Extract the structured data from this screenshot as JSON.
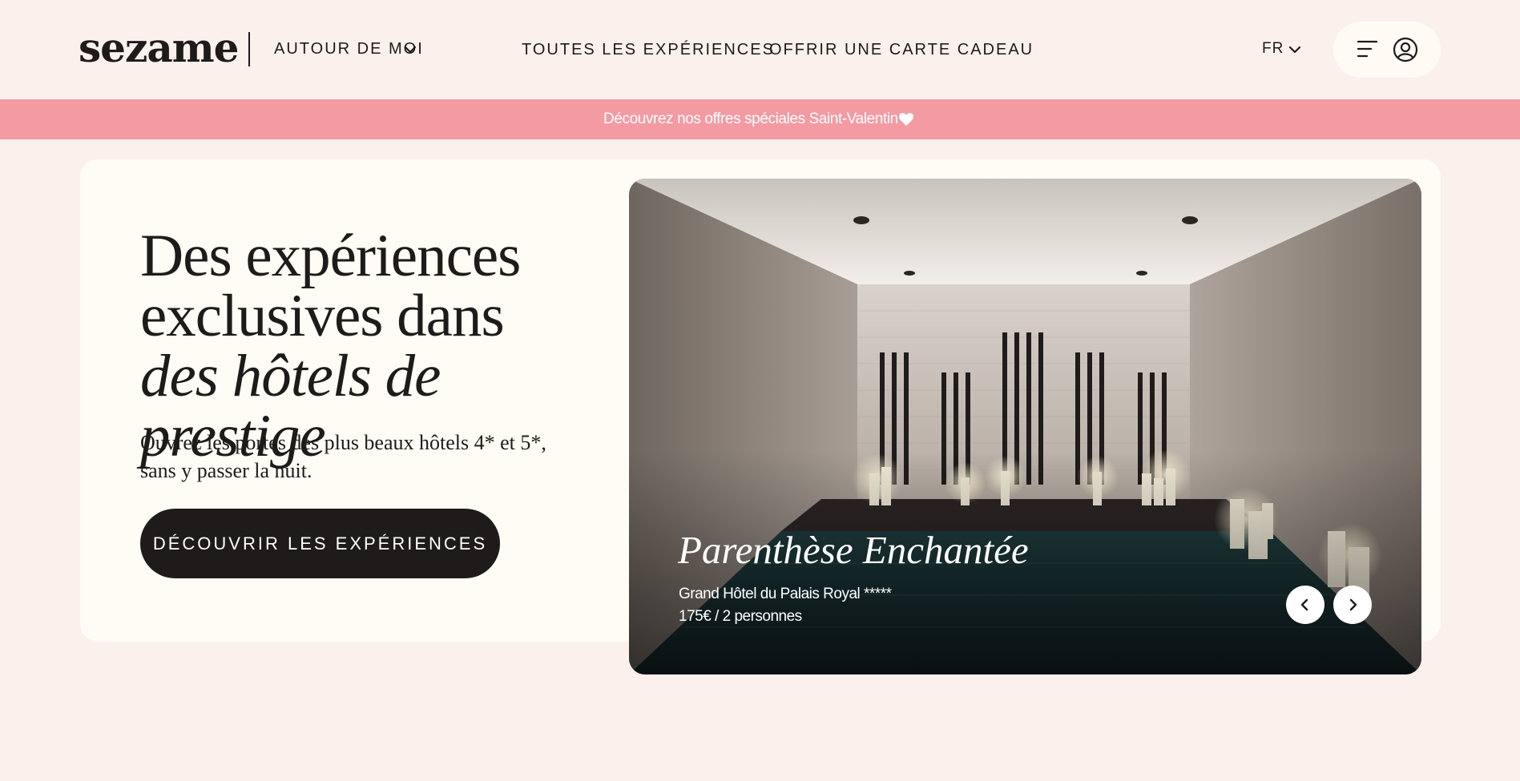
{
  "header": {
    "logo": "sezame",
    "about_label": "AUTOUR DE MOI",
    "nav": {
      "experiences": "TOUTES LES EXPÉRIENCES",
      "gift_card": "OFFRIR UNE CARTE CADEAU"
    },
    "language": "FR",
    "icons": [
      "chevron-down-icon",
      "menu-icon",
      "user-icon"
    ]
  },
  "promo": {
    "text": "Découvrez nos offres spéciales Saint-Valentin",
    "icon": "heart-icon",
    "background": "#f49aa3"
  },
  "hero": {
    "title_line1": "Des expériences",
    "title_line2": "exclusives dans",
    "title_line3_italic": "des hôtels de prestige",
    "subtitle": "Ouvrez les portes des plus beaux hôtels 4* et 5*, sans y passer la nuit.",
    "cta_label": "DÉCOUVRIR LES EXPÉRIENCES"
  },
  "featured": {
    "title": "Parenthèse Enchantée",
    "hotel": "Grand Hôtel du Palais Royal *****",
    "price": "175€ / 2 personnes",
    "icons": [
      "chevron-left-icon",
      "chevron-right-icon"
    ]
  },
  "colors": {
    "page_bg": "#fbf0ec",
    "card_bg": "#fffcf5",
    "ink": "#1e1b1a",
    "promo": "#f49aa3"
  }
}
